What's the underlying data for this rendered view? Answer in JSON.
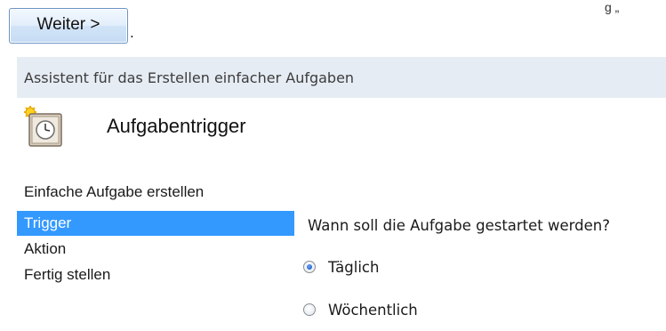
{
  "top": {
    "next_button_label": "Weiter >",
    "trailing_text": ".",
    "clipped_top_right_text": "g         „"
  },
  "wizard": {
    "title": "Assistent für das Erstellen einfacher Aufgaben",
    "header_title": "Aufgabentrigger",
    "icon": "clock-sun-icon",
    "steps": [
      {
        "label": "Einfache Aufgabe erstellen",
        "selected": false
      },
      {
        "label": "Trigger",
        "selected": true
      },
      {
        "label": "Aktion",
        "selected": false
      },
      {
        "label": "Fertig stellen",
        "selected": false
      }
    ],
    "question": "Wann soll die Aufgabe gestartet werden?",
    "options": [
      {
        "label": "Täglich",
        "checked": true
      },
      {
        "label": "Wöchentlich",
        "checked": false
      }
    ]
  },
  "colors": {
    "selection": "#3399ff",
    "titlebar": "#e6ecf4",
    "button_border": "#6d93c4"
  }
}
